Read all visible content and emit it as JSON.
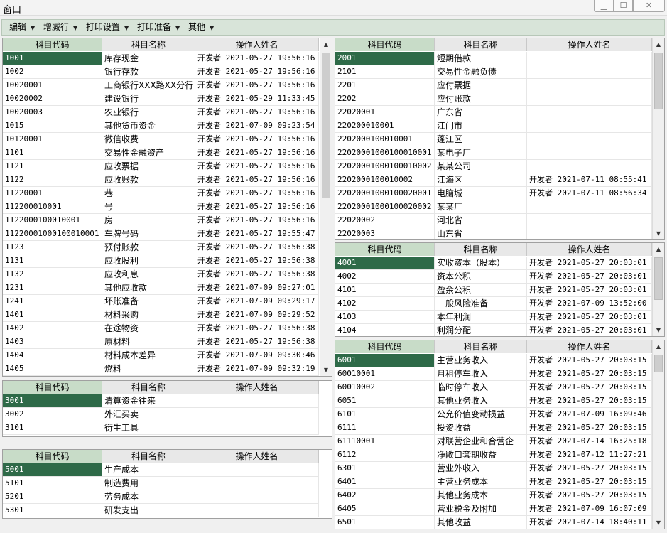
{
  "window": {
    "title": "窗口",
    "min_icon": "minimize-icon",
    "max_icon": "maximize-icon",
    "close_icon": "close-icon"
  },
  "menu": [
    {
      "label": "编辑"
    },
    {
      "label": "增减行"
    },
    {
      "label": "打印设置"
    },
    {
      "label": "打印准备"
    },
    {
      "label": "其他"
    }
  ],
  "columns": {
    "code": "科目代码",
    "name": "科目名称",
    "operator": "操作人姓名"
  },
  "panels": {
    "assets": {
      "rows": [
        {
          "code": "1001",
          "name": "库存现金",
          "op": "开发者 2021-05-27 19:56:16"
        },
        {
          "code": "1002",
          "name": "银行存款",
          "op": "开发者 2021-05-27 19:56:16"
        },
        {
          "code": "10020001",
          "name": "工商银行XXX路XX分行",
          "op": "开发者 2021-05-27 19:56:16"
        },
        {
          "code": "10020002",
          "name": "建设银行",
          "op": "开发者 2021-05-29 11:33:45"
        },
        {
          "code": "10020003",
          "name": "农业银行",
          "op": "开发者 2021-05-27 19:56:16"
        },
        {
          "code": "1015",
          "name": "其他货币资金",
          "op": "开发者 2021-07-09 09:23:54"
        },
        {
          "code": "10120001",
          "name": "微信收费",
          "op": "开发者 2021-05-27 19:56:16"
        },
        {
          "code": "1101",
          "name": "交易性金融资产",
          "op": "开发者 2021-05-27 19:56:16"
        },
        {
          "code": "1121",
          "name": "应收票据",
          "op": "开发者 2021-05-27 19:56:16"
        },
        {
          "code": "1122",
          "name": "应收账款",
          "op": "开发者 2021-05-27 19:56:16"
        },
        {
          "code": "11220001",
          "name": "巷",
          "op": "开发者 2021-05-27 19:56:16"
        },
        {
          "code": "112200010001",
          "name": "号",
          "op": "开发者 2021-05-27 19:56:16"
        },
        {
          "code": "1122000100010001",
          "name": "房",
          "op": "开发者 2021-05-27 19:56:16"
        },
        {
          "code": "11220001000100010001",
          "name": "车牌号码",
          "op": "开发者 2021-05-27 19:55:47"
        },
        {
          "code": "1123",
          "name": "预付账款",
          "op": "开发者 2021-05-27 19:56:38"
        },
        {
          "code": "1131",
          "name": "应收股利",
          "op": "开发者 2021-05-27 19:56:38"
        },
        {
          "code": "1132",
          "name": "应收利息",
          "op": "开发者 2021-05-27 19:56:38"
        },
        {
          "code": "1231",
          "name": "其他应收款",
          "op": "开发者 2021-07-09 09:27:01"
        },
        {
          "code": "1241",
          "name": "坏账准备",
          "op": "开发者 2021-07-09 09:29:17"
        },
        {
          "code": "1401",
          "name": "材料采购",
          "op": "开发者 2021-07-09 09:29:52"
        },
        {
          "code": "1402",
          "name": "在途物资",
          "op": "开发者 2021-05-27 19:56:38"
        },
        {
          "code": "1403",
          "name": "原材料",
          "op": "开发者 2021-05-27 19:56:38"
        },
        {
          "code": "1404",
          "name": "材料成本差异",
          "op": "开发者 2021-07-09 09:30:46"
        },
        {
          "code": "1405",
          "name": "燃料",
          "op": "开发者 2021-07-09 09:32:19"
        }
      ]
    },
    "common": {
      "rows": [
        {
          "code": "3001",
          "name": "清算资金往来",
          "op": ""
        },
        {
          "code": "3002",
          "name": "外汇买卖",
          "op": ""
        },
        {
          "code": "3101",
          "name": "衍生工具",
          "op": ""
        }
      ]
    },
    "cost": {
      "rows": [
        {
          "code": "5001",
          "name": "生产成本",
          "op": ""
        },
        {
          "code": "5101",
          "name": "制造费用",
          "op": ""
        },
        {
          "code": "5201",
          "name": "劳务成本",
          "op": ""
        },
        {
          "code": "5301",
          "name": "研发支出",
          "op": ""
        }
      ]
    },
    "liabilities": {
      "rows": [
        {
          "code": "2001",
          "name": "短期借款",
          "op": ""
        },
        {
          "code": "2101",
          "name": "交易性金融负债",
          "op": ""
        },
        {
          "code": "2201",
          "name": "应付票据",
          "op": ""
        },
        {
          "code": "2202",
          "name": "应付账款",
          "op": ""
        },
        {
          "code": "22020001",
          "name": "广东省",
          "op": ""
        },
        {
          "code": "220200010001",
          "name": "江门市",
          "op": ""
        },
        {
          "code": "2202000100010001",
          "name": "蓬江区",
          "op": ""
        },
        {
          "code": "22020001000100010001",
          "name": "某电子厂",
          "op": ""
        },
        {
          "code": "22020001000100010002",
          "name": "某某公司",
          "op": ""
        },
        {
          "code": "2202000100010002",
          "name": "江海区",
          "op": "开发者 2021-07-11 08:55:41"
        },
        {
          "code": "22020001000100020001",
          "name": "电脑城",
          "op": "开发者 2021-07-11 08:56:34"
        },
        {
          "code": "22020001000100020002",
          "name": "某某厂",
          "op": ""
        },
        {
          "code": "22020002",
          "name": "河北省",
          "op": ""
        },
        {
          "code": "22020003",
          "name": "山东省",
          "op": ""
        }
      ]
    },
    "equity": {
      "rows": [
        {
          "code": "4001",
          "name": "实收资本（股本）",
          "op": "开发者 2021-05-27 20:03:01"
        },
        {
          "code": "4002",
          "name": "资本公积",
          "op": "开发者 2021-05-27 20:03:01"
        },
        {
          "code": "4101",
          "name": "盈余公积",
          "op": "开发者 2021-05-27 20:03:01"
        },
        {
          "code": "4102",
          "name": "一般风险准备",
          "op": "开发者 2021-07-09 13:52:00"
        },
        {
          "code": "4103",
          "name": "本年利润",
          "op": "开发者 2021-05-27 20:03:01"
        },
        {
          "code": "4104",
          "name": "利润分配",
          "op": "开发者 2021-05-27 20:03:01"
        }
      ]
    },
    "profit": {
      "rows": [
        {
          "code": "6001",
          "name": "主营业务收入",
          "op": "开发者 2021-05-27 20:03:15"
        },
        {
          "code": "60010001",
          "name": "月租停车收入",
          "op": "开发者 2021-05-27 20:03:15"
        },
        {
          "code": "60010002",
          "name": "临时停车收入",
          "op": "开发者 2021-05-27 20:03:15"
        },
        {
          "code": "6051",
          "name": "其他业务收入",
          "op": "开发者 2021-05-27 20:03:15"
        },
        {
          "code": "6101",
          "name": "公允价值变动损益",
          "op": "开发者 2021-07-09 16:09:46"
        },
        {
          "code": "6111",
          "name": "投资收益",
          "op": "开发者 2021-05-27 20:03:15"
        },
        {
          "code": "61110001",
          "name": "对联营企业和合营企",
          "op": "开发者 2021-07-14 16:25:18"
        },
        {
          "code": "6112",
          "name": "净敞口套期收益",
          "op": "开发者 2021-07-12 11:27:21"
        },
        {
          "code": "6301",
          "name": "营业外收入",
          "op": "开发者 2021-05-27 20:03:15"
        },
        {
          "code": "6401",
          "name": "主营业务成本",
          "op": "开发者 2021-05-27 20:03:15"
        },
        {
          "code": "6402",
          "name": "其他业务成本",
          "op": "开发者 2021-05-27 20:03:15"
        },
        {
          "code": "6405",
          "name": "营业税金及附加",
          "op": "开发者 2021-07-09 16:07:09"
        },
        {
          "code": "6501",
          "name": "其他收益",
          "op": "开发者 2021-07-14 18:40:11"
        }
      ]
    }
  }
}
